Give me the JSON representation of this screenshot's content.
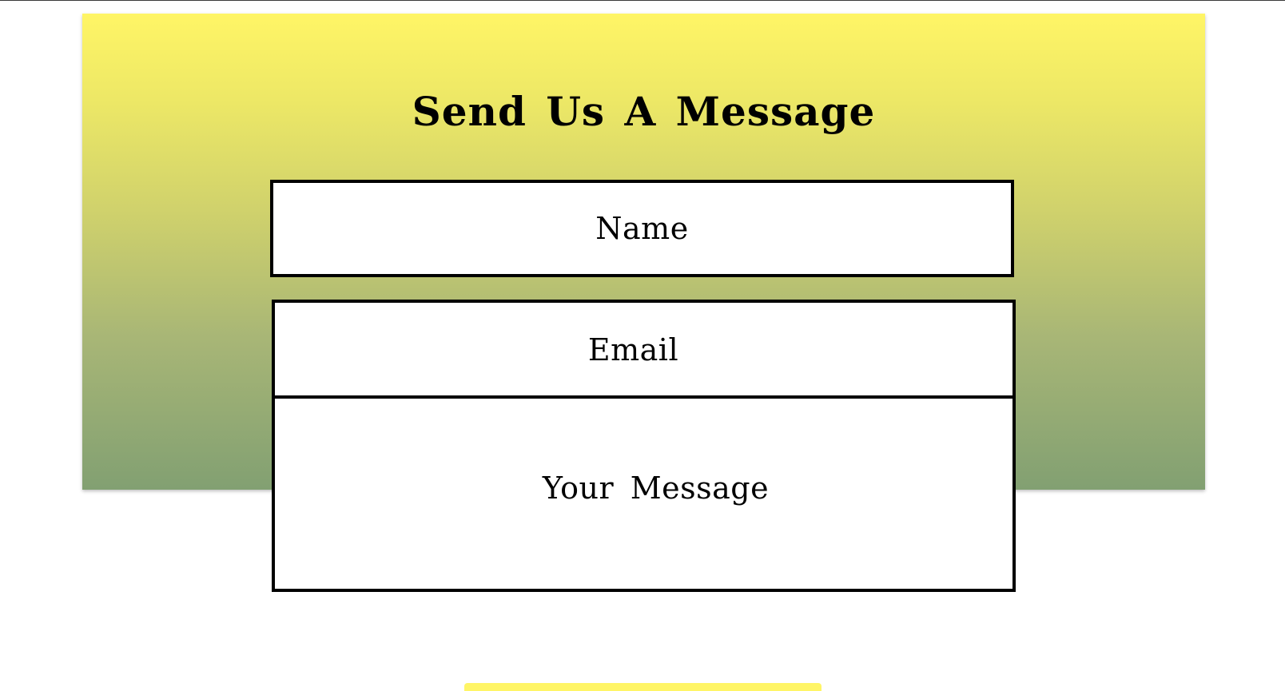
{
  "colors": {
    "gradient_top": "#fff566",
    "gradient_bottom": "#82a072",
    "field_border": "#000000",
    "button_accent": "#fff566"
  },
  "contact": {
    "title": "Send Us A Message",
    "name_placeholder": "Name",
    "email_placeholder": "Email",
    "message_placeholder": "Your Message"
  }
}
